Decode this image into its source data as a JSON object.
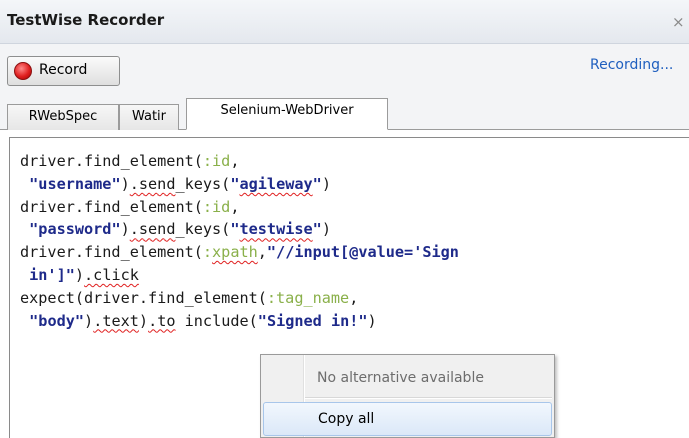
{
  "window": {
    "title": "TestWise Recorder",
    "close_label": "×"
  },
  "toolbar": {
    "record_label": "Record",
    "status": "Recording..."
  },
  "tabs": [
    {
      "label": "RWebSpec",
      "active": false
    },
    {
      "label": "Watir",
      "active": false
    },
    {
      "label": "Selenium-WebDriver",
      "active": true
    }
  ],
  "editor": {
    "lines": [
      "driver.find_element(:id,",
      " \"username\").send_keys(\"agileway\")",
      "driver.find_element(:id,",
      " \"password\").send_keys(\"testwise\")",
      "driver.find_element(:xpath,\"//input[@value='Sign",
      " in']\").click",
      "expect(driver.find_element(:tag_name,",
      " \"body\").text).to include(\"Signed in!\")"
    ]
  },
  "context_menu": {
    "items": [
      {
        "label": "No alternative available",
        "enabled": false
      },
      {
        "label": "Copy all",
        "enabled": true,
        "highlighted": true
      }
    ]
  },
  "colors": {
    "symbol": "#8ab04a",
    "string": "#1e2a8a",
    "status": "#1f5fbf",
    "record": "#e02020"
  }
}
